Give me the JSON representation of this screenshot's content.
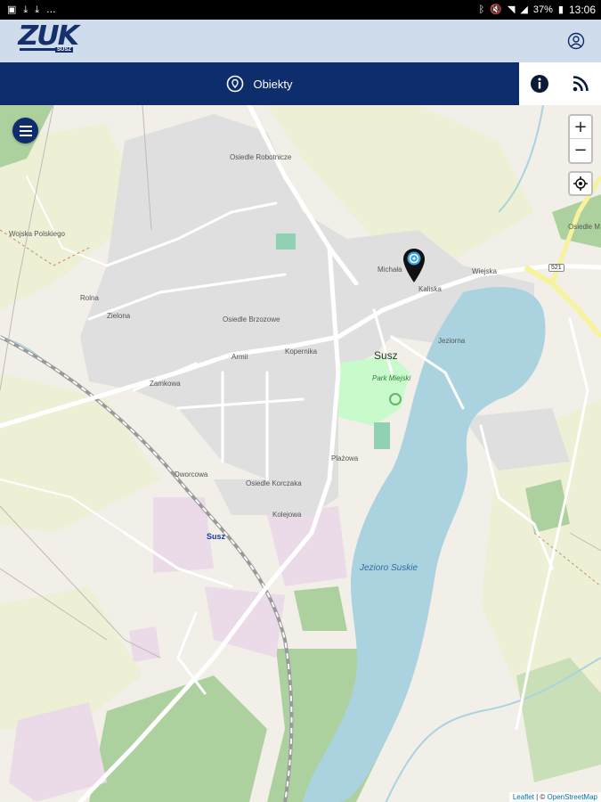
{
  "status_bar": {
    "left_icons": [
      "image-icon",
      "download-icon",
      "download-icon",
      "more-icon"
    ],
    "left_more": "...",
    "battery": "37%",
    "time": "13:06"
  },
  "header": {
    "logo_text": "ZUK",
    "logo_sub": "SUSZ"
  },
  "tabs": {
    "main_label": "Obiekty",
    "main_icon": "location-pin-icon",
    "info_icon": "info-icon",
    "rss_icon": "rss-icon"
  },
  "map": {
    "zoom_in": "+",
    "zoom_out": "−",
    "attribution_leaflet": "Leaflet",
    "attribution_sep": " | © ",
    "attribution_osm": "OpenStreetMap",
    "labels": {
      "osiedle_robotnicze": "Osiedle Robotnicze",
      "osiedle_brzozowe": "Osiedle Brzozowe",
      "osiedle_korczaka": "Osiedle Korczaka",
      "osiedle_m": "Osiedle M",
      "susz_town": "Susz",
      "park": "Park Miejski",
      "lake": "Jezioro Suskie",
      "station": "Susz",
      "route": "521",
      "michala": "Michała",
      "kaliska": "Kaliska",
      "wiejska": "Wiejska",
      "armii": "Armii",
      "kopernika": "Kopernika",
      "zamkowa": "Zamkowa",
      "plazowa": "Plażowa",
      "kolejowa": "Kolejowa",
      "dworcowa": "Dworcowa",
      "zielona": "Zielona",
      "wojska_polskiego": "Wojska Polskiego",
      "jeziorna": "Jeziorna",
      "rolna": "Rolna"
    }
  },
  "colors": {
    "primary": "#0d2d6c",
    "header_bg": "#cfdcec",
    "water": "#aad3df",
    "forest": "#add19e",
    "residential": "#e0dfdf",
    "industrial": "#ebdbe8"
  }
}
